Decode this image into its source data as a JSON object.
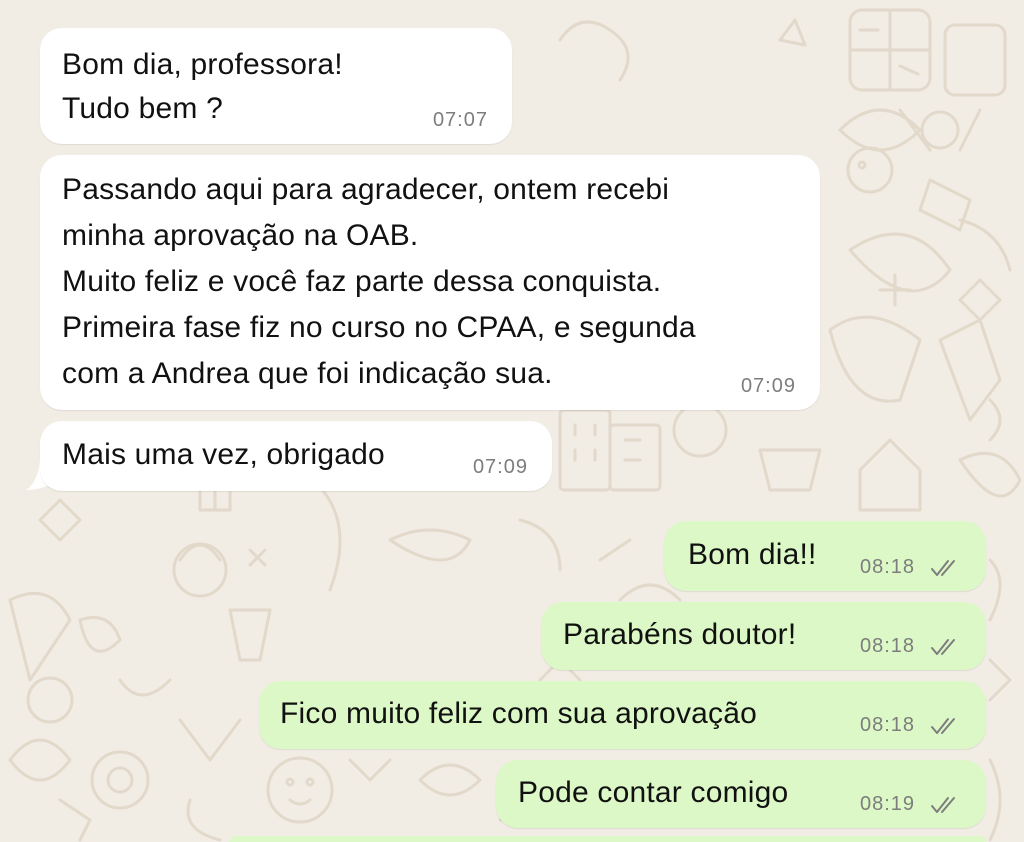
{
  "colors": {
    "wallpaper": "#f1ece4",
    "incoming_bubble": "#ffffff",
    "outgoing_bubble": "#dcf8c6",
    "timestamp": "#7d7d7d",
    "read_ticks": "#7d7d7d"
  },
  "icons": {
    "read_receipt": "double-check-icon"
  },
  "messages": [
    {
      "direction": "incoming",
      "lines": [
        "Bom dia, professora!",
        "Tudo bem ?"
      ],
      "time": "07:07"
    },
    {
      "direction": "incoming",
      "lines": [
        "Passando aqui para agradecer, ontem recebi",
        "minha aprovação na OAB.",
        "Muito feliz e você faz parte dessa conquista.",
        "Primeira fase fiz no curso no CPAA, e segunda",
        "com a Andrea que foi indicação sua."
      ],
      "time": "07:09"
    },
    {
      "direction": "incoming",
      "lines": [
        "Mais uma vez, obrigado"
      ],
      "time": "07:09"
    },
    {
      "direction": "outgoing",
      "lines": [
        "Bom dia!!"
      ],
      "time": "08:18",
      "read": true
    },
    {
      "direction": "outgoing",
      "lines": [
        "Parabéns doutor!"
      ],
      "time": "08:18",
      "read": true
    },
    {
      "direction": "outgoing",
      "lines": [
        "Fico muito feliz com sua aprovação"
      ],
      "time": "08:18",
      "read": true
    },
    {
      "direction": "outgoing",
      "lines": [
        "Pode contar comigo"
      ],
      "time": "08:19",
      "read": true
    }
  ]
}
